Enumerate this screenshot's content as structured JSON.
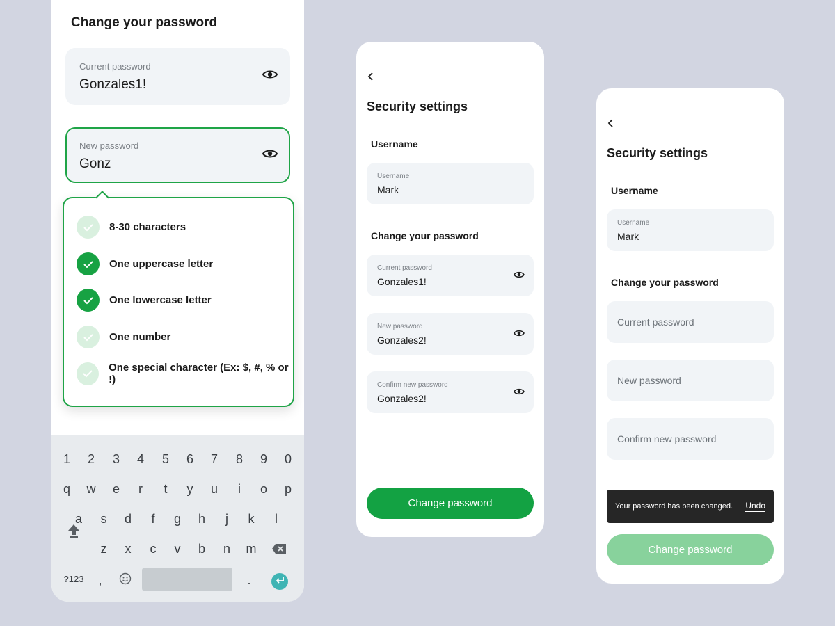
{
  "phone1": {
    "title": "Change your password",
    "current_field": {
      "label": "Current password",
      "value": "Gonzales1!",
      "icon": "eye-icon"
    },
    "new_field": {
      "label": "New password",
      "value": "Gonz",
      "icon": "eye-icon"
    },
    "rules": [
      {
        "label": "8-30 characters",
        "met": false
      },
      {
        "label": "One uppercase letter",
        "met": true
      },
      {
        "label": "One lowercase letter",
        "met": true
      },
      {
        "label": "One number",
        "met": false
      },
      {
        "label": "One special character (Ex: $, #, % or !)",
        "met": false
      }
    ],
    "keyboard": {
      "row1": [
        "1",
        "2",
        "3",
        "4",
        "5",
        "6",
        "7",
        "8",
        "9",
        "0"
      ],
      "row2": [
        "q",
        "w",
        "e",
        "r",
        "t",
        "y",
        "u",
        "i",
        "o",
        "p"
      ],
      "row3": [
        "a",
        "s",
        "d",
        "f",
        "g",
        "h",
        "j",
        "k",
        "l"
      ],
      "row4": [
        "z",
        "x",
        "c",
        "v",
        "b",
        "n",
        "m"
      ],
      "symbols_key": "?123",
      "comma_key": ",",
      "period_key": "."
    }
  },
  "phone2": {
    "title": "Security settings",
    "username_heading": "Username",
    "username_field": {
      "label": "Username",
      "value": "Mark"
    },
    "password_heading": "Change your password",
    "current_field": {
      "label": "Current password",
      "value": "Gonzales1!"
    },
    "new_field": {
      "label": "New password",
      "value": "Gonzales2!"
    },
    "confirm_field": {
      "label": "Confirm new password",
      "value": "Gonzales2!"
    },
    "button_label": "Change password"
  },
  "phone3": {
    "title": "Security settings",
    "username_heading": "Username",
    "username_field": {
      "label": "Username",
      "value": "Mark"
    },
    "password_heading": "Change your password",
    "current_placeholder": "Current password",
    "new_placeholder": "New password",
    "confirm_placeholder": "Confirm new password",
    "toast_message": "Your password has been changed.",
    "toast_action": "Undo",
    "button_label": "Change password"
  },
  "colors": {
    "background": "#d2d5e1",
    "accent_green": "#13a243",
    "disabled_green": "#88d29c",
    "field_bg": "#f1f4f7",
    "toast_bg": "#262626"
  }
}
